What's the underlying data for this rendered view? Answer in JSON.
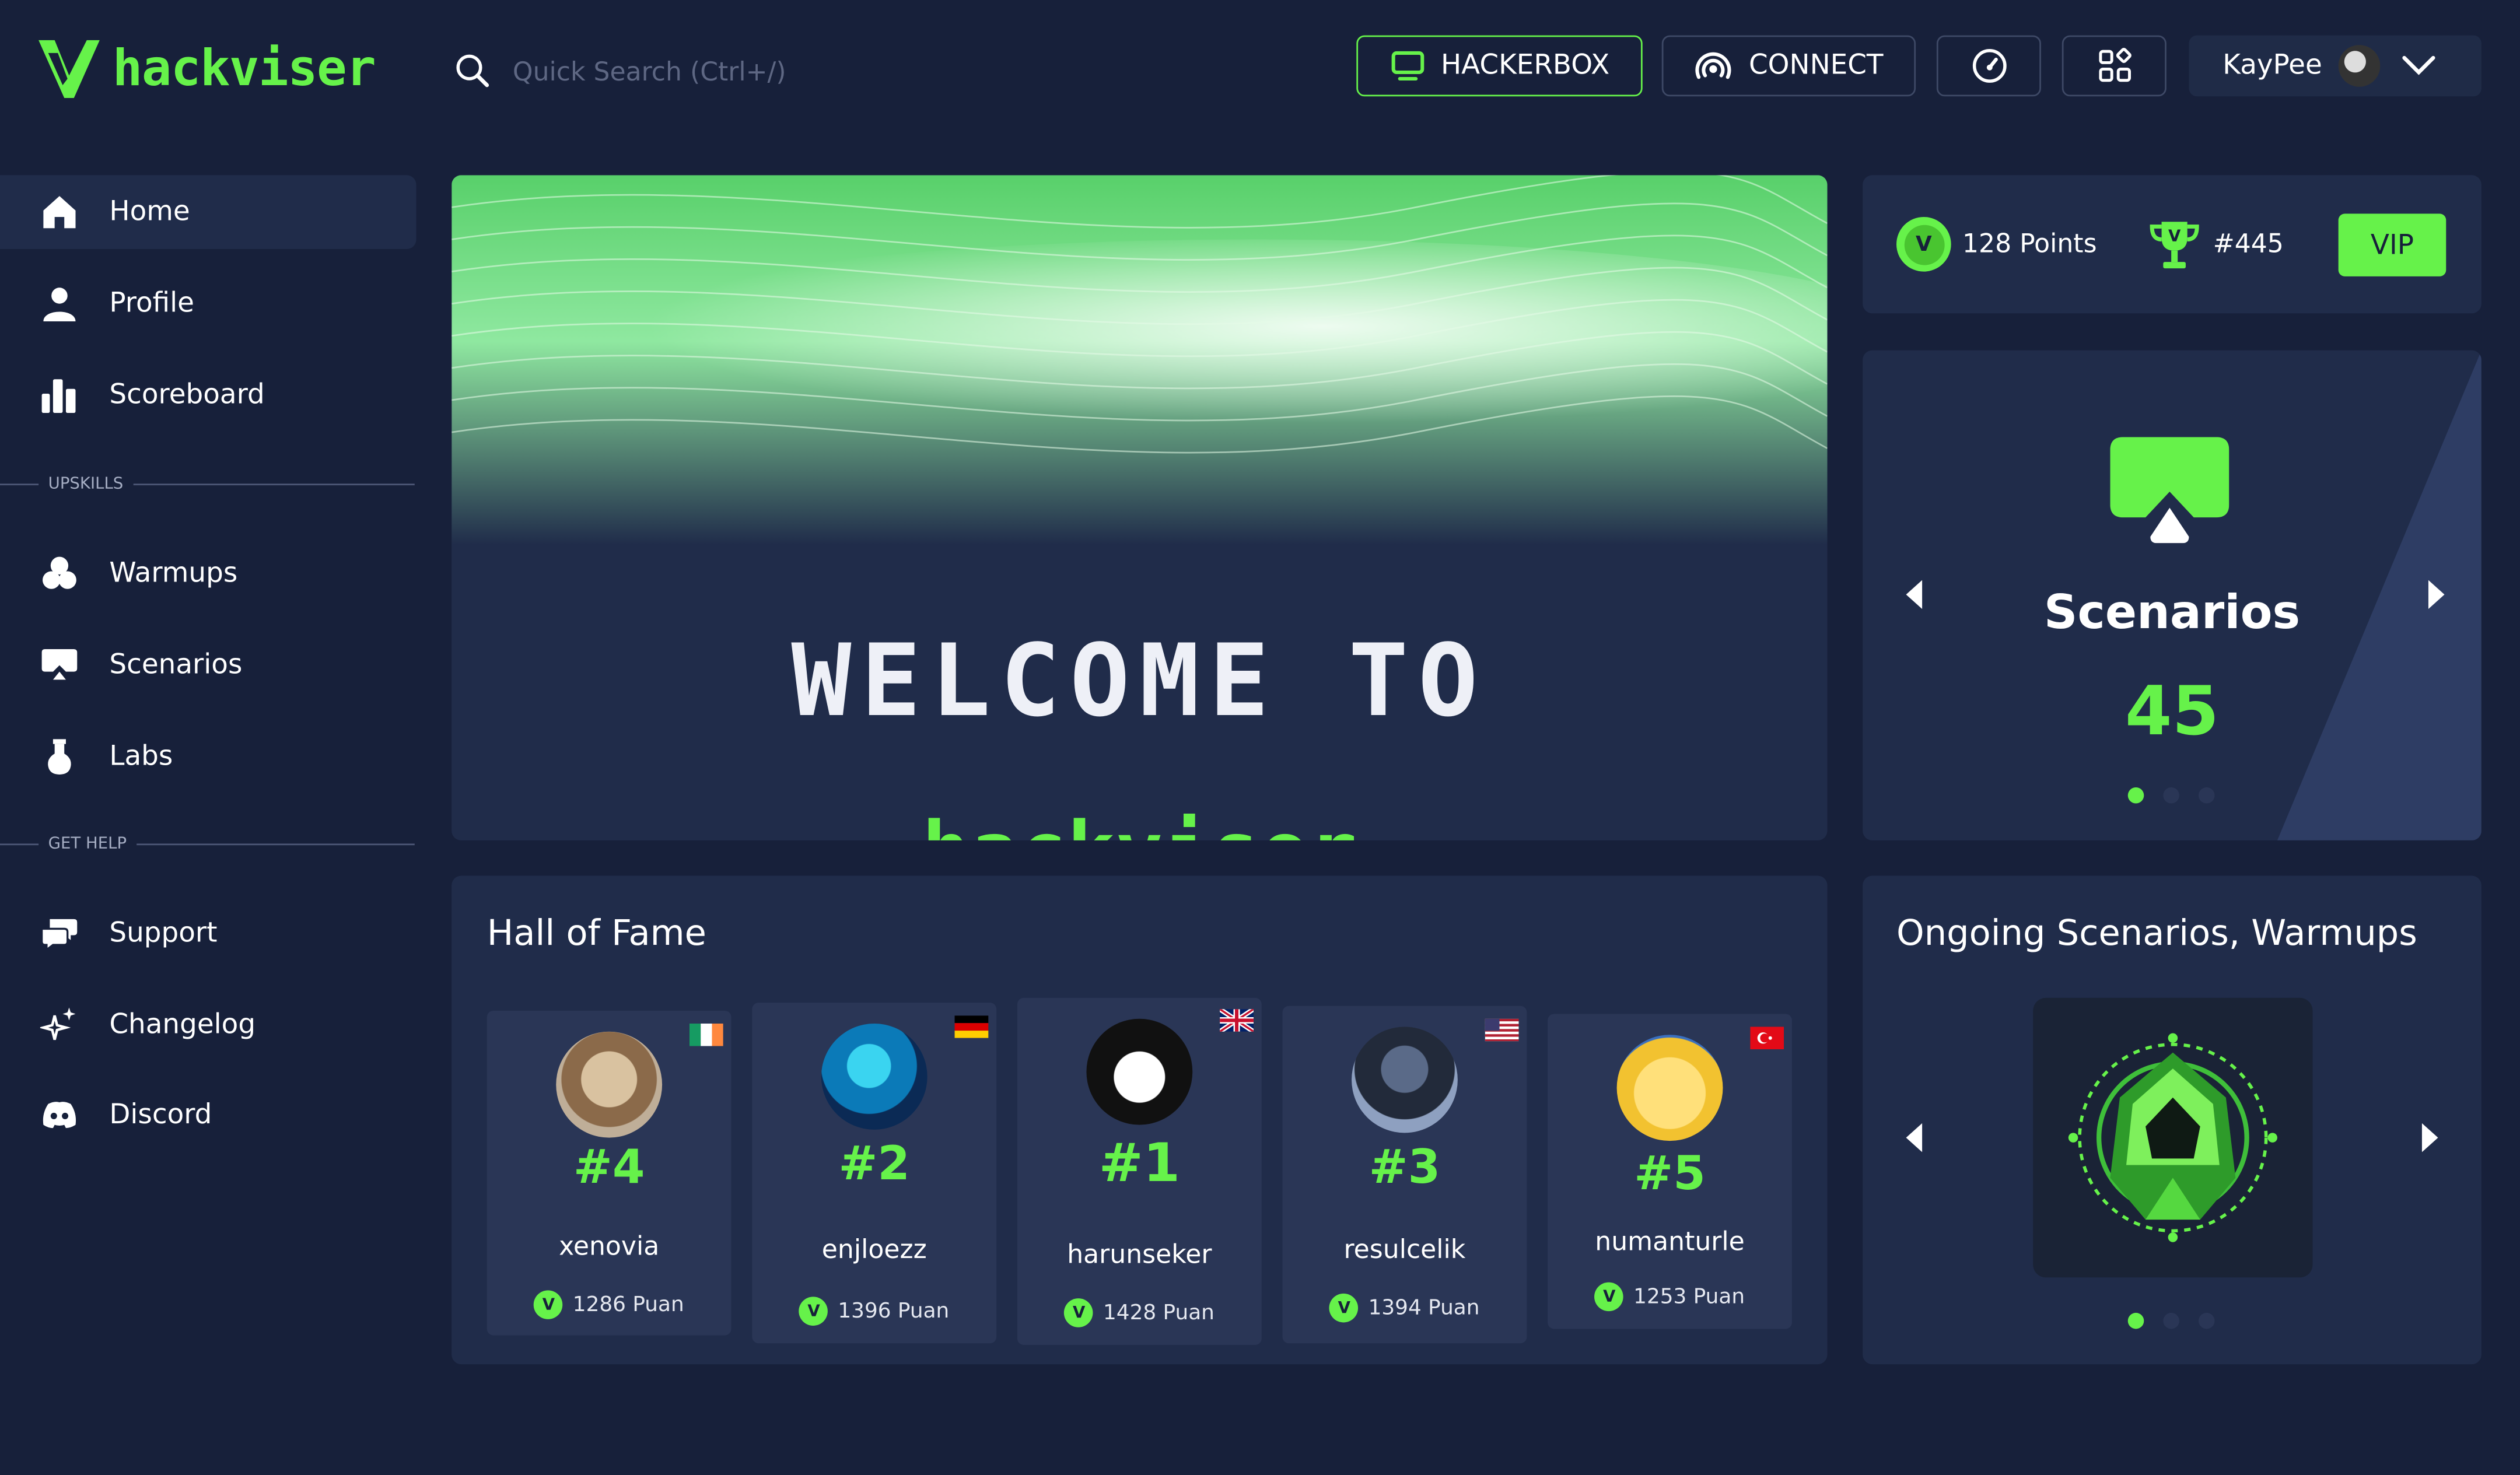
{
  "header": {
    "brand": "hackviser",
    "search_placeholder": "Quick Search (Ctrl+/)",
    "hackerbox_label": "HACKERBOX",
    "connect_label": "CONNECT",
    "username": "KayPee"
  },
  "sidebar": {
    "items": [
      {
        "label": "Home",
        "icon": "home-icon"
      },
      {
        "label": "Profile",
        "icon": "user-icon"
      },
      {
        "label": "Scoreboard",
        "icon": "bar-chart-icon"
      },
      {
        "label": "Warmups",
        "icon": "warmups-icon"
      },
      {
        "label": "Scenarios",
        "icon": "scenarios-icon"
      },
      {
        "label": "Labs",
        "icon": "flask-icon"
      },
      {
        "label": "Support",
        "icon": "chat-bubbles-icon"
      },
      {
        "label": "Changelog",
        "icon": "sparkle-icon"
      },
      {
        "label": "Discord",
        "icon": "discord-icon"
      }
    ],
    "sections": {
      "upskills": "UPSKILLS",
      "get_help": "GET HELP"
    }
  },
  "hero": {
    "line1": "WELCOME TO",
    "line2": "hackviser"
  },
  "stats": {
    "points": "128 Points",
    "rank": "#445",
    "vip_label": "VIP"
  },
  "scenario_card": {
    "title": "Scenarios",
    "count": "45"
  },
  "hall_of_fame": {
    "title": "Hall of Fame",
    "players": [
      {
        "rank": "#4",
        "name": "xenovia",
        "points": "1286 Puan",
        "flag": "ireland"
      },
      {
        "rank": "#2",
        "name": "enjloezz",
        "points": "1396 Puan",
        "flag": "germany"
      },
      {
        "rank": "#1",
        "name": "harunseker",
        "points": "1428 Puan",
        "flag": "united-kingdom"
      },
      {
        "rank": "#3",
        "name": "resulcelik",
        "points": "1394 Puan",
        "flag": "united-states"
      },
      {
        "rank": "#5",
        "name": "numanturle",
        "points": "1253 Puan",
        "flag": "turkey"
      }
    ]
  },
  "ongoing": {
    "title": "Ongoing Scenarios, Warmups"
  },
  "colors": {
    "accent": "#66f24a",
    "background": "#17203a",
    "panel": "#202c4a",
    "card": "#2a3656"
  }
}
